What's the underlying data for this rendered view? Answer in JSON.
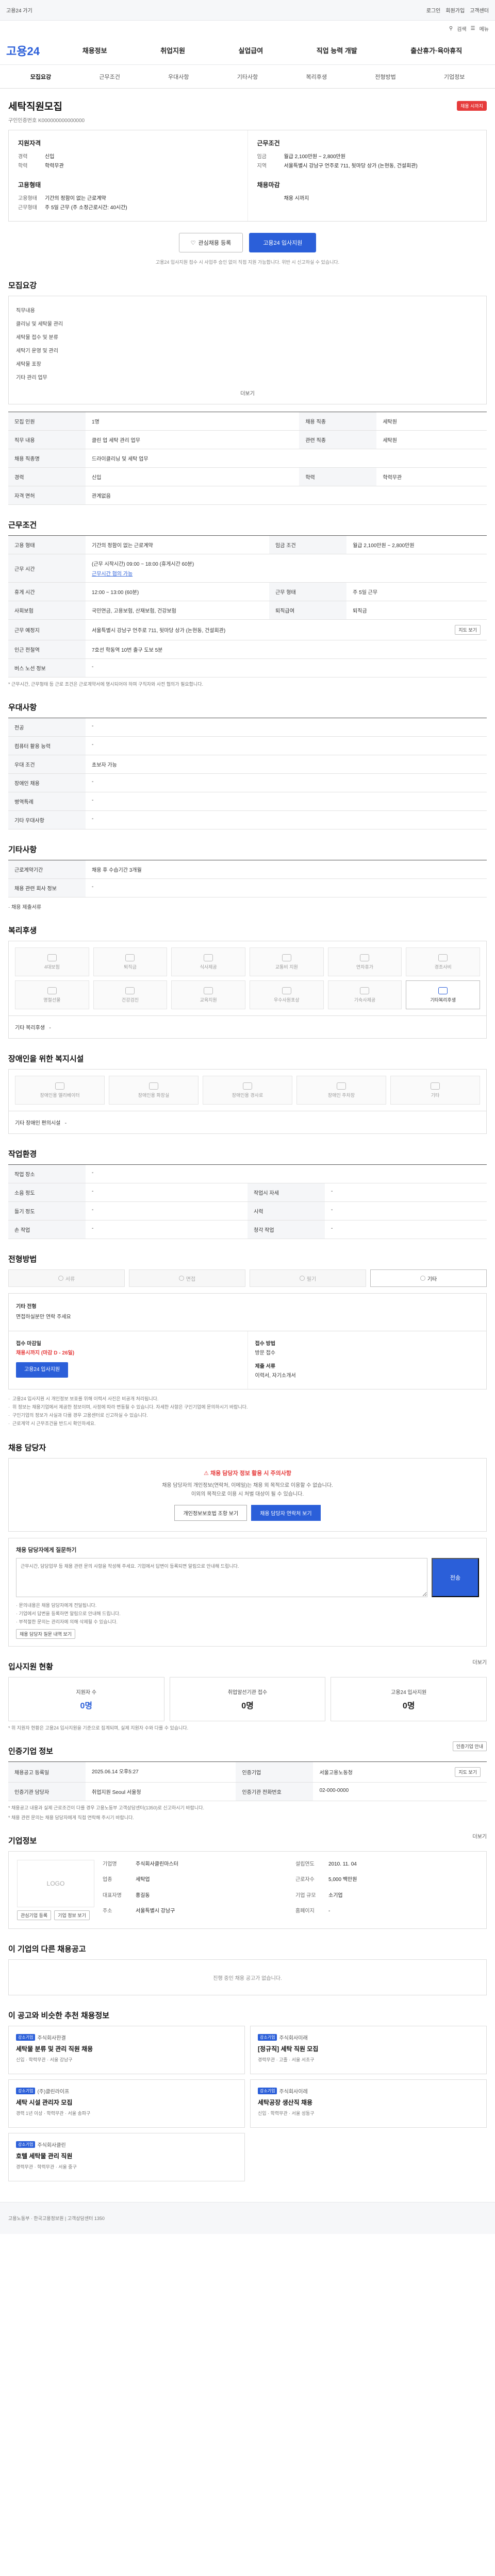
{
  "util": {
    "left": "고용24 가기",
    "right": [
      "로그인",
      "회원가입",
      "고객센터"
    ]
  },
  "search_row": {
    "items": [
      "검색",
      "메뉴"
    ]
  },
  "gnb": {
    "logo": "고용24",
    "menu": [
      "채용정보",
      "취업지원",
      "실업급여",
      "직업 능력 개발",
      "출산휴가·육아휴직"
    ]
  },
  "tabs": [
    "모집요강",
    "근무조건",
    "우대사항",
    "기타사항",
    "복리후생",
    "전형방법",
    "기업정보"
  ],
  "job": {
    "title": "세탁직원모집",
    "badge": "채용 시까지",
    "id_text": "구인인증번호 K000000000000000",
    "left_title": "지원자격",
    "left_rows": [
      {
        "k": "경력",
        "v": "신입"
      },
      {
        "k": "학력",
        "v": "학력무관"
      }
    ],
    "left_title2": "고용형태",
    "left_rows2": [
      {
        "k": "고용형태",
        "v": "기간의 정함이 없는 근로계약"
      },
      {
        "k": "근무형태",
        "v": "주 5일 근무 (주 소정근로시간: 40시간)"
      }
    ],
    "right_title": "근무조건",
    "right_rows": [
      {
        "k": "임금",
        "v": "월급 2,100만원 ~ 2,800만원"
      },
      {
        "k": "지역",
        "v": "서울특별시 강남구 언주로 711, 뒷마당 상가 (논현동, 건설회관)"
      }
    ],
    "right_title2": "채용마감",
    "right_rows2": [
      {
        "k": "",
        "v": "채용 시까지"
      }
    ],
    "btn_interest": "관심채용 등록",
    "btn_apply": "고용24 입사지원",
    "notice": "고용24 입사지원 접수 시 사업주 승인 없이 직접 지원 가능합니다. 위반 시 신고하실 수 있습니다."
  },
  "recruit": {
    "title": "모집요강",
    "scroll_lines": [
      "직무내용",
      "클리닝 및 세탁물 관리",
      "세탁물 접수 및 분류",
      "세탁기 운영 및 관리",
      "세탁물 포장",
      "기타 관리 업무"
    ],
    "scroll_more": "더보기",
    "rows": [
      [
        {
          "k": "모집 인원",
          "v": "1명"
        },
        {
          "k": "채용 직종",
          "v": "세탁원"
        }
      ],
      [
        {
          "k": "직무 내용",
          "v": "클린 업 세탁 관리 업무"
        },
        {
          "k": "관련 직종",
          "v": "세탁원"
        }
      ],
      [
        {
          "k": "채용 직종명",
          "v": "드라이클리닝 및 세탁 업무"
        },
        {
          "k": "",
          "v": ""
        }
      ],
      [
        {
          "k": "경력",
          "v": "신입"
        },
        {
          "k": "학력",
          "v": "학력무관"
        }
      ],
      [
        {
          "k": "자격 면허",
          "v": "관계없음"
        },
        {
          "k": "",
          "v": ""
        }
      ]
    ]
  },
  "work": {
    "title": "근무조건",
    "rows": [
      [
        {
          "k": "고용 형태",
          "v": "기간의 정함이 없는 근로계약"
        },
        {
          "k": "임금 조건",
          "v": "월급 2,100만원 ~ 2,800만원"
        }
      ],
      [
        {
          "k": "근무 시간",
          "v": "(근무 시작시간) 09:00 ~ 18:00 (휴게시간 60분)",
          "v2": "근무시간 협의 가능",
          "link": "근무시간 협의 가능"
        },
        {
          "k": "",
          "v": ""
        }
      ],
      [
        {
          "k": "휴게 시간",
          "v": "12:00 ~ 13:00 (60분)"
        },
        {
          "k": "근무 형태",
          "v": "주 5일 근무"
        }
      ],
      [
        {
          "k": "사회보험",
          "v": "국민연금, 고용보험, 산재보험, 건강보험"
        },
        {
          "k": "퇴직급여",
          "v": "퇴직금"
        }
      ],
      [
        {
          "k": "근무 예정지",
          "v": "서울특별시 강남구 언주로 711, 뒷마당 상가 (논현동, 건설회관)",
          "btn": "지도 보기"
        },
        {
          "k": "",
          "v": ""
        }
      ],
      [
        {
          "k": "인근 전철역",
          "v": "7호선 학동역 10번 출구 도보 5분"
        },
        {
          "k": "",
          "v": ""
        }
      ],
      [
        {
          "k": "버스 노선 정보",
          "v": "-"
        },
        {
          "k": "",
          "v": ""
        }
      ]
    ],
    "note": "* 근무시간, 근무형태 등 근로 조건은 근로계약서에 명시되어야 하며 구직자와 사전 협의가 필요합니다."
  },
  "pref": {
    "title": "우대사항",
    "rows": [
      {
        "k": "전공",
        "v": "-"
      },
      {
        "k": "컴퓨터 활용 능력",
        "v": "-"
      },
      {
        "k": "우대 조건",
        "v": "초보자 가능"
      },
      {
        "k": "장애인 채용",
        "v": "-"
      },
      {
        "k": "병역특례",
        "v": "-"
      },
      {
        "k": "기타 우대사항",
        "v": "-"
      }
    ]
  },
  "etc": {
    "title": "기타사항",
    "rows": [
      {
        "k": "근로계약기간",
        "v": "채용 후 수습기간 3개월"
      },
      {
        "k": "채용 관련 회사 정보",
        "v": "-"
      }
    ],
    "extra": "· 채용 제출서류"
  },
  "welfare": {
    "title": "복리후생",
    "items": [
      "4대보험",
      "퇴직금",
      "식사제공",
      "교통비 지원",
      "연차휴가",
      "경조사비",
      "명절선물",
      "건강검진",
      "교육지원",
      "우수사원포상",
      "기숙사제공",
      "기타복리후생"
    ],
    "active": [
      11
    ],
    "extra_label": "기타 복리후생",
    "extra_value": "-"
  },
  "facility": {
    "title": "장애인을 위한 복지시설",
    "items": [
      "장애인용 엘리베이터",
      "장애인용 화장실",
      "장애인용 경사로",
      "장애인 주차장",
      "기타"
    ],
    "extra_label": "기타 장애인 편의시설",
    "extra_value": "-"
  },
  "env": {
    "title": "작업환경",
    "rows": [
      [
        {
          "k": "작업 장소",
          "v": "-"
        },
        {
          "k": "",
          "v": ""
        }
      ],
      [
        {
          "k": "소음 정도",
          "v": "-"
        },
        {
          "k": "작업시 자세",
          "v": "-"
        }
      ],
      [
        {
          "k": "들기 정도",
          "v": "-"
        },
        {
          "k": "시력",
          "v": "-"
        }
      ],
      [
        {
          "k": "손 작업",
          "v": "-"
        },
        {
          "k": "청각 작업",
          "v": "-"
        }
      ]
    ]
  },
  "method": {
    "title": "전형방법",
    "items": [
      "서류",
      "면접",
      "필기",
      "기타"
    ],
    "active": [
      3
    ],
    "other_label": "기타 전형",
    "other_value": "면접하실분만 연락 주세요",
    "apply_label": "접수 마감일",
    "apply_strong": "채용시까지 (마감 D - 26일)",
    "apply_way_label": "접수 방법",
    "apply_way": "방문 접수",
    "submit_label": "제출 서류",
    "submit_value": "이력서, 자기소개서",
    "apply_btn": "고용24 입사지원",
    "bullets": [
      "고용24 입사지원 시 개인정보 보호를 위해 이력서 사진은 비공개 처리됩니다.",
      "위 정보는 채용기업에서 제공한 정보이며, 사정에 따라 변동될 수 있습니다. 자세한 사항은 구인기업에 문의하시기 바랍니다.",
      "구인기업의 정보가 사실과 다를 경우 고용센터로 신고하실 수 있습니다.",
      "근로계약 시 근무조건을 반드시 확인하세요."
    ]
  },
  "contact": {
    "title": "채용 담당자",
    "warn": "채용 담당자 정보 활용 시 주의사항",
    "desc1": "채용 담당자의 개인정보(연락처, 이메일)는 채용 외 목적으로 이용할 수 없습니다.",
    "desc2": "이외의 목적으로 이용 시 처벌 대상이 될 수 있습니다.",
    "btn1": "개인정보보호법 조항 보기",
    "btn2": "채용 담당자 연락처 보기",
    "inq_title": "채용 담당자에게 질문하기",
    "inq_placeholder": "근무시간, 담당업무 등 채용 관련 문의 사항을 작성해 주세요. 기업에서 답변이 등록되면 알림으로 안내해 드립니다.",
    "inq_btn": "전송",
    "inq_notes": [
      "· 문의내용은 채용 담당자에게 전달됩니다.",
      "· 기업에서 답변을 등록하면 알림으로 안내해 드립니다.",
      "· 부적절한 문의는 관리자에 의해 삭제될 수 있습니다."
    ],
    "inq_check": "채용 담당자 질문 내역 보기"
  },
  "status": {
    "title": "입사지원 현황",
    "more": "더보기",
    "cards": [
      {
        "lbl": "지원자 수",
        "val": "0명"
      },
      {
        "lbl": "취업알선기관 접수",
        "val": "0명"
      },
      {
        "lbl": "고용24 입사지원",
        "val": "0명"
      }
    ],
    "note": "* 위 지원자 현황은 고용24 입사지원을 기준으로 집계되며, 실제 지원자 수와 다를 수 있습니다."
  },
  "register": {
    "title": "인증기업 정보",
    "btn": "인증기업 안내",
    "rows": [
      [
        {
          "k": "채용공고 등록일",
          "v": "2025.06.14 오후5:27"
        },
        {
          "k": "인증기업",
          "v": "서울고용노동청",
          "btn": "지도 보기"
        }
      ],
      [
        {
          "k": "인증기관 담당자",
          "v": "취업지원 Seoul 서울청"
        },
        {
          "k": "인증기관 전화번호",
          "v": "02-000-0000"
        }
      ]
    ],
    "notes": [
      "* 채용공고 내용과 실제 근로조건이 다를 경우 고용노동부 고객상담센터(1350)로 신고하시기 바랍니다.",
      "* 채용 관련 문의는 채용 담당자에게 직접 연락해 주시기 바랍니다."
    ]
  },
  "company": {
    "title": "기업정보",
    "more": "더보기",
    "logo": "LOGO",
    "rows": [
      {
        "k": "기업명",
        "v": "주식회사클린마스터"
      },
      {
        "k": "설립연도",
        "v": "2010. 11. 04"
      },
      {
        "k": "업종",
        "v": "세탁업"
      },
      {
        "k": "근로자수",
        "v": "5,000 백만원"
      },
      {
        "k": "대표자명",
        "v": "홍길동"
      },
      {
        "k": "기업 규모",
        "v": "소기업"
      },
      {
        "k": "주소",
        "v": "서울특별시 강남구"
      },
      {
        "k": "홈페이지",
        "v": "-"
      }
    ],
    "btn1": "관심기업 등록",
    "btn2": "기업 정보 보기"
  },
  "other_jobs": {
    "title": "이 기업의 다른 채용공고",
    "empty": "진행 중인 채용 공고가 없습니다."
  },
  "recommend": {
    "title": "이 공고와 비슷한 추천 채용정보",
    "cards": [
      {
        "chip": "강소기업",
        "company": "주식회사한결",
        "title": "세탁물 분류 및 관리 직원 채용",
        "meta": "신입 · 학력무관 · 서울 강남구"
      },
      {
        "chip": "강소기업",
        "company": "주식회사미래",
        "title": "[정규직] 세탁 직원 모집",
        "meta": "경력무관 · 고졸 · 서울 서초구"
      },
      {
        "chip": "강소기업",
        "company": "(주)클린라이프",
        "title": "세탁 시설 관리자 모집",
        "meta": "경력 1년 이상 · 학력무관 · 서울 송파구"
      },
      {
        "chip": "강소기업",
        "company": "주식회사이레",
        "title": "세탁공장 생산직 채용",
        "meta": "신입 · 학력무관 · 서울 성동구"
      },
      {
        "chip": "강소기업",
        "company": "주식회사클린",
        "title": "호텔 세탁물 관리 직원",
        "meta": "경력무관 · 학력무관 · 서울 중구"
      },
      {
        "chip": "",
        "company": "",
        "title": "",
        "meta": ""
      }
    ]
  },
  "footer": {
    "text": "고용노동부 · 한국고용정보원 | 고객상담센터 1350"
  }
}
